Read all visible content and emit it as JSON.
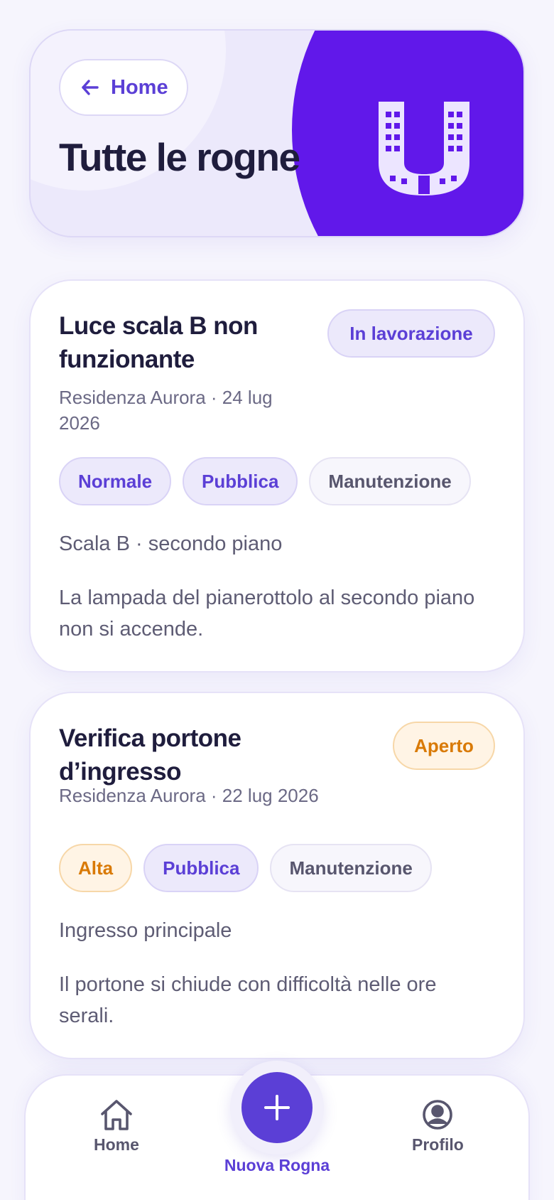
{
  "header": {
    "back_label": "Home",
    "title": "Tutte le rogne"
  },
  "cards": [
    {
      "title": "Luce scala B non funzionante",
      "meta": "Residenza Aurora · 24 lug 2026",
      "status": "In lavorazione",
      "tags": [
        "Normale",
        "Pubblica",
        "Manutenzione"
      ],
      "location": "Scala B · secondo piano",
      "description": "La lampada del pianerottolo al secondo piano non si accende."
    },
    {
      "title": "Verifica portone d’ingresso",
      "meta": "Residenza Aurora · 22 lug 2026",
      "status": "Aperto",
      "tags": [
        "Alta",
        "Pubblica",
        "Manutenzione"
      ],
      "location": "Ingresso principale",
      "description": "Il portone si chiude con difficoltà nelle ore serali."
    }
  ],
  "nav": {
    "home_label": "Home",
    "new_label": "Nuova Rogna",
    "profile_label": "Profilo"
  },
  "colors": {
    "accent": "#5b3fd6",
    "brand": "#6118ea",
    "status_open": "#d97a06",
    "background": "#f6f5fd"
  },
  "icons": {
    "back": "arrow-left-icon",
    "logo": "building-u-logo",
    "home": "home-icon",
    "add": "plus-icon",
    "profile": "user-circle-icon"
  }
}
